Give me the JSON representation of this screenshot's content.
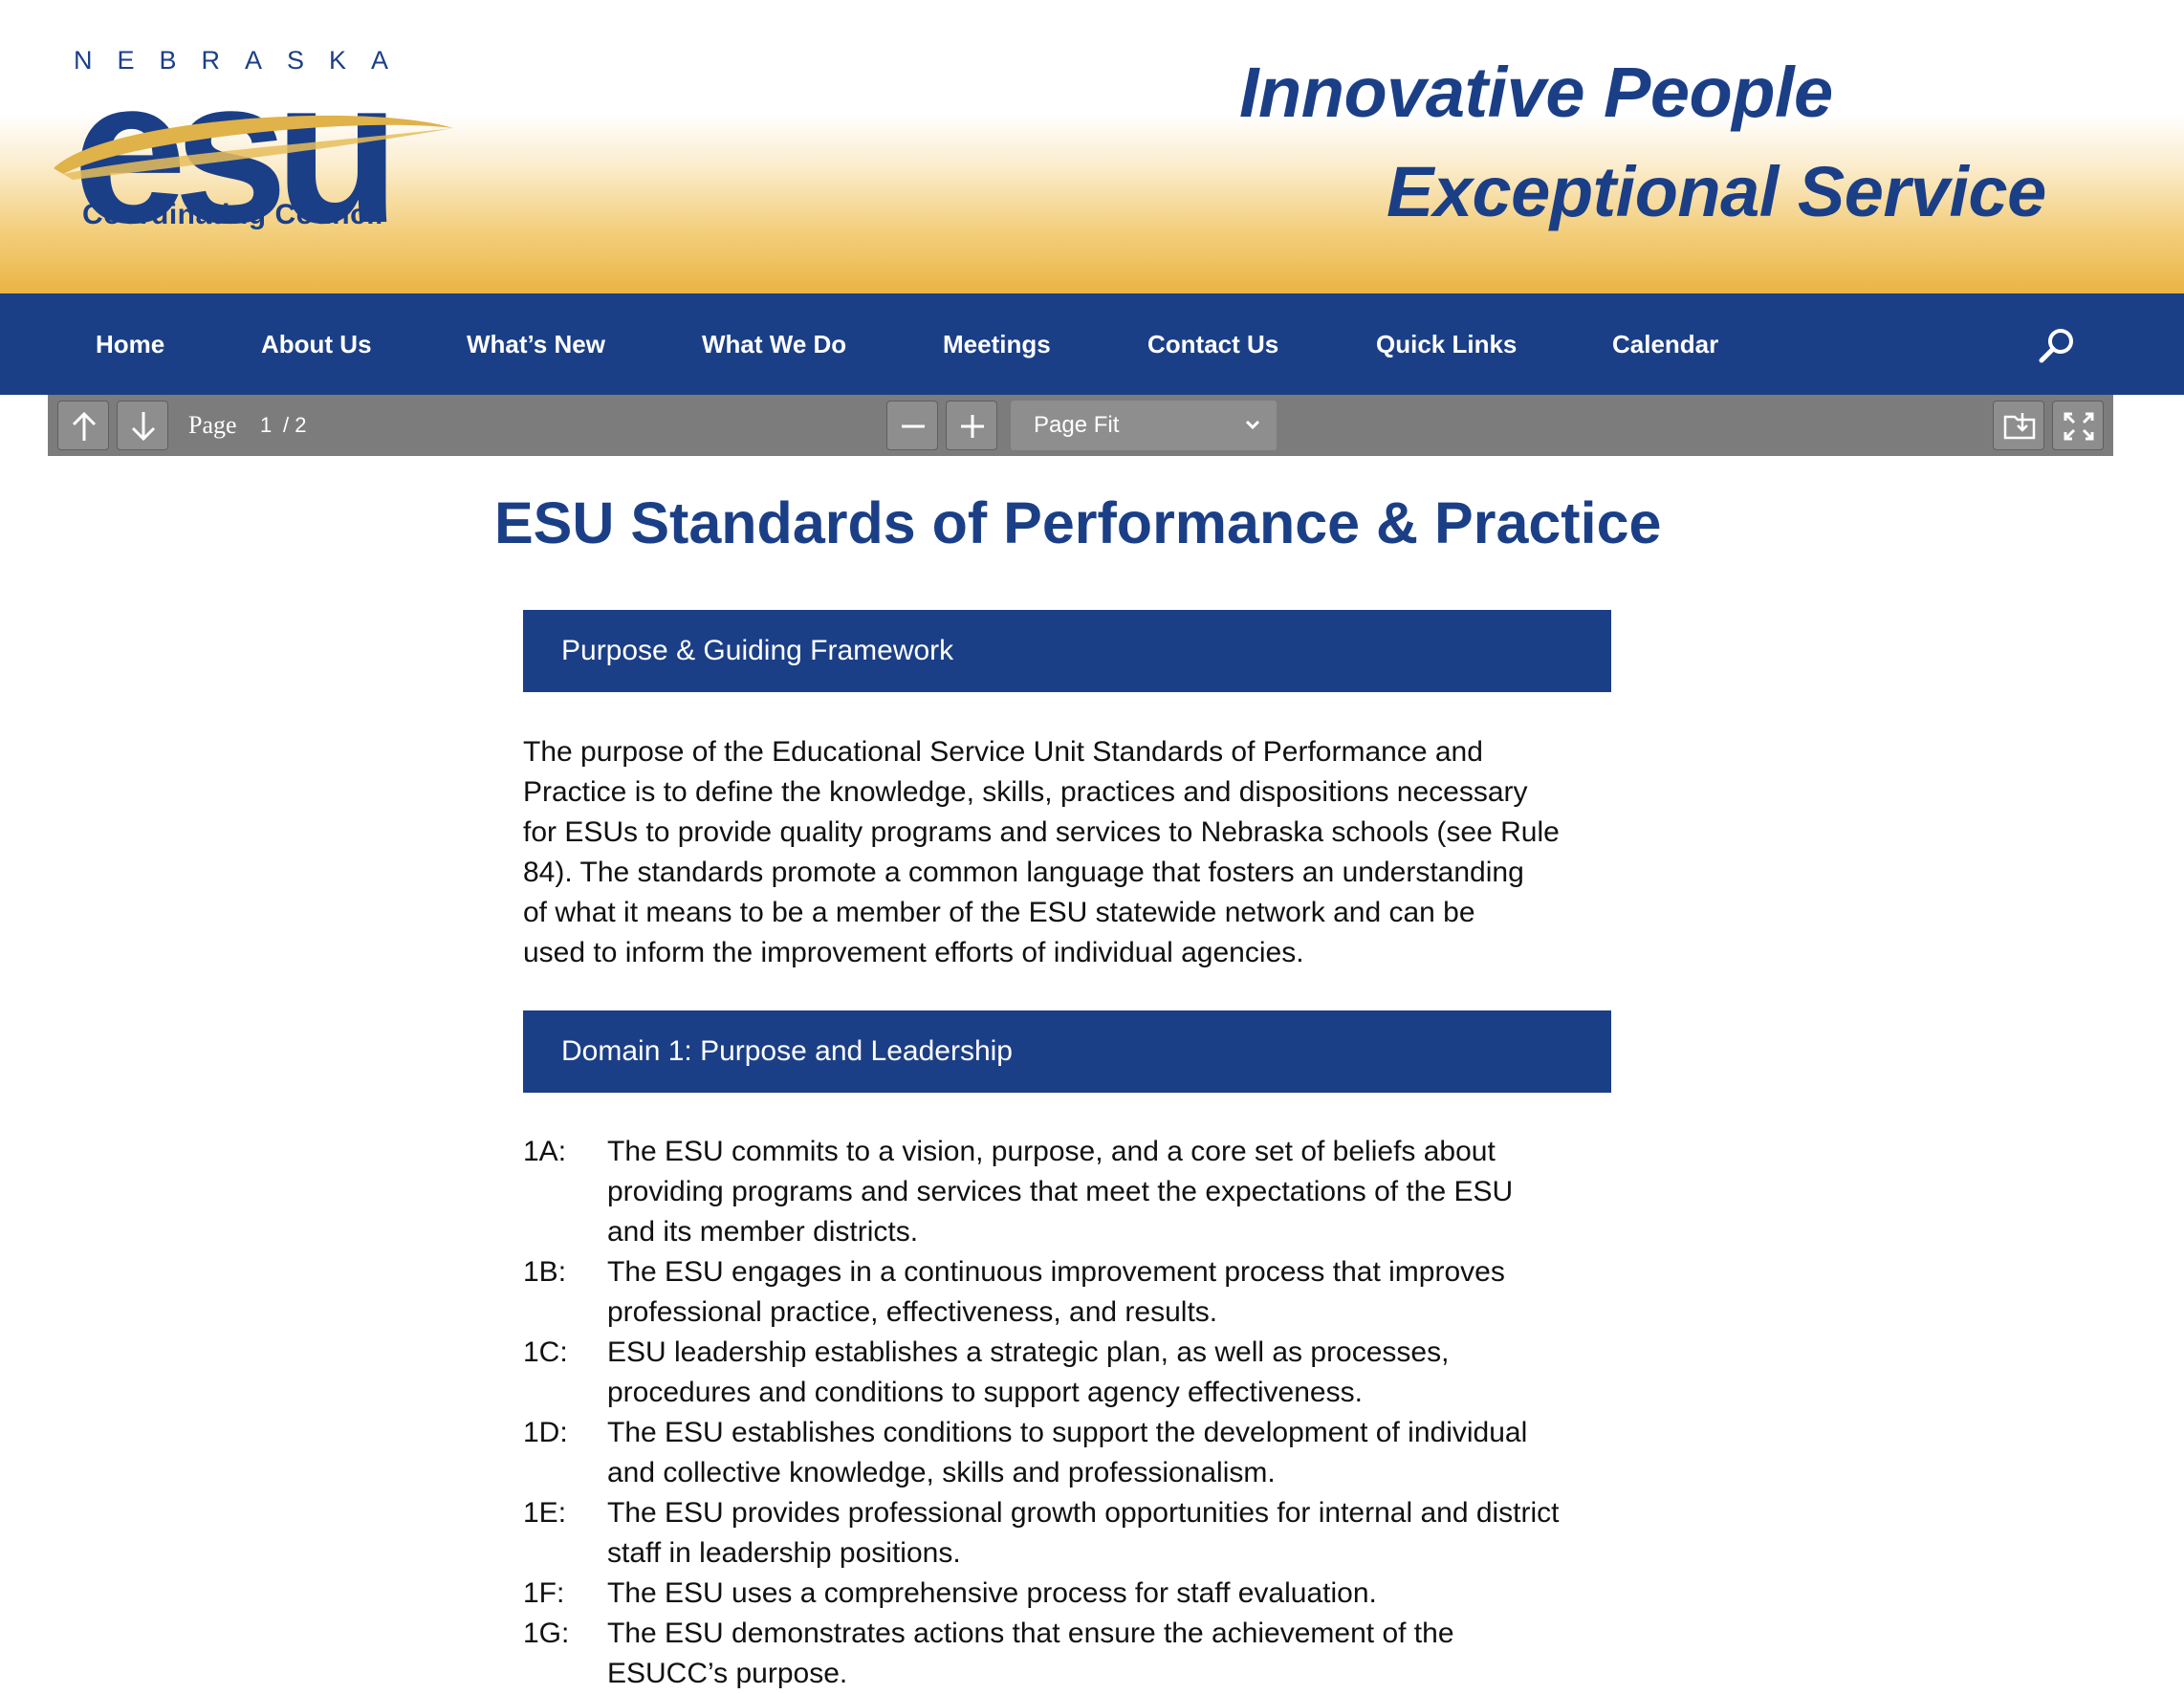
{
  "header": {
    "logo": {
      "state": "NEBRASKA",
      "wordmark": "esu",
      "subtitle": "Coordinating Council"
    },
    "tagline_line1": "Innovative People",
    "tagline_line2": "Exceptional Service"
  },
  "nav": {
    "items": [
      "Home",
      "About Us",
      "What’s New",
      "What We Do",
      "Meetings",
      "Contact Us",
      "Quick Links",
      "Calendar"
    ],
    "search_icon": "search-icon"
  },
  "pdf_toolbar": {
    "page_label": "Page",
    "current_page": "1",
    "total_pages": "/ 2",
    "zoom": "Page Fit",
    "icons": [
      "arrow-up-icon",
      "arrow-down-icon",
      "minus-icon",
      "plus-icon",
      "chevron-down-icon",
      "download-icon",
      "fullscreen-icon"
    ]
  },
  "document": {
    "title": "ESU Standards of Performance & Practice",
    "section1": {
      "heading": "Purpose & Guiding Framework",
      "lines": [
        "The purpose of the Educational Service Unit Standards of Performance and",
        "Practice is to define the knowledge, skills, practices and dispositions necessary",
        "for ESUs to provide quality programs and services to Nebraska schools (see Rule",
        "84). The standards promote a common language that fosters an understanding",
        "of what it means to be a member of the ESU statewide network and can be",
        "used to inform the improvement efforts of individual agencies."
      ]
    },
    "section2": {
      "heading": "Domain 1: Purpose and Leadership",
      "standards": [
        {
          "code": "1A:",
          "lines": [
            "The ESU commits to a vision, purpose, and a core set of beliefs about",
            "providing programs and services that meet the expectations of the ESU",
            "and its member districts."
          ]
        },
        {
          "code": "1B:",
          "lines": [
            "The ESU engages in a continuous improvement process that improves",
            "professional practice, effectiveness, and results."
          ]
        },
        {
          "code": "1C:",
          "lines": [
            "ESU leadership establishes a strategic plan, as well as processes,",
            "procedures and conditions to support agency effectiveness."
          ]
        },
        {
          "code": "1D:",
          "lines": [
            "The ESU establishes conditions to support the development of individual",
            "and collective knowledge, skills and professionalism."
          ]
        },
        {
          "code": "1E:",
          "lines": [
            "The ESU provides professional growth opportunities for internal and district",
            "staff in leadership positions."
          ]
        },
        {
          "code": "1F:",
          "lines": [
            "The ESU uses a comprehensive process for staff evaluation."
          ]
        },
        {
          "code": "1G:",
          "lines": [
            "The ESU demonstrates actions that ensure the achievement of the",
            "ESUCC’s purpose."
          ]
        }
      ]
    }
  },
  "colors": {
    "brand_blue": "#1b3f87",
    "gold": "#ebb444",
    "toolbar_gray": "#7c7c7c"
  }
}
